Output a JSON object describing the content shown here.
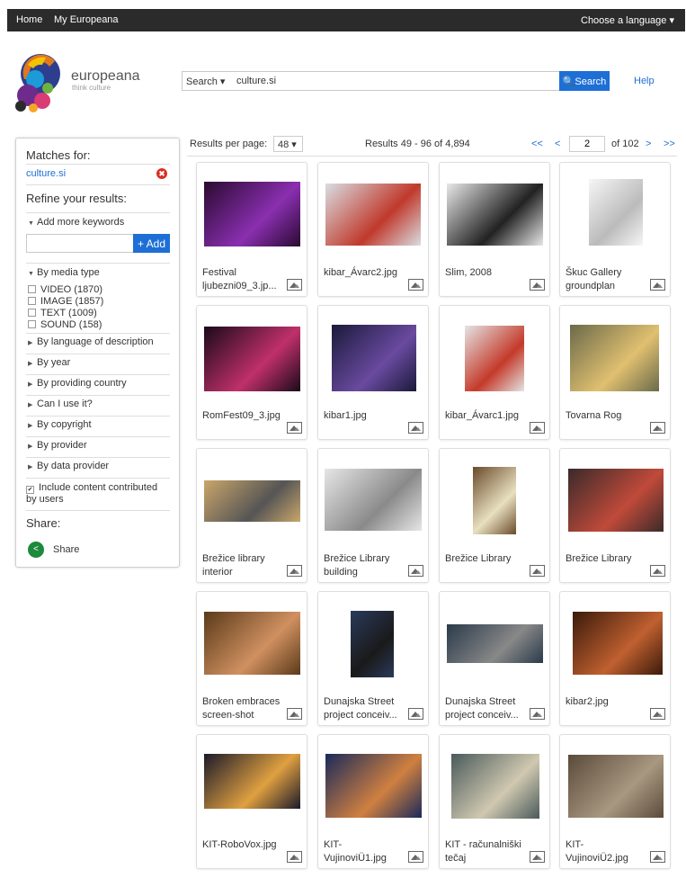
{
  "topbar": {
    "home": "Home",
    "my": "My Europeana",
    "lang": "Choose a language ▾"
  },
  "brand": {
    "name": "europeana",
    "tagline": "think culture"
  },
  "search": {
    "scope": "Search ▾",
    "query": "culture.si",
    "button": "🔍Search",
    "help": "Help"
  },
  "sidebar": {
    "matches_heading": "Matches for:",
    "query": "culture.si",
    "remove_icon": "✖",
    "refine_heading": "Refine your results:",
    "add_keywords": "Add more keywords",
    "add_button": "+ Add",
    "media_type": "By media type",
    "media_types": [
      "VIDEO (1870)",
      "IMAGE (1857)",
      "TEXT (1009)",
      "SOUND (158)"
    ],
    "facets": [
      "By language of description",
      "By year",
      "By providing country",
      "Can I use it?",
      "By copyright",
      "By provider",
      "By data provider"
    ],
    "ugc_label": "Include content contributed by users",
    "share_heading": "Share:",
    "share_label": "Share"
  },
  "results": {
    "rpp_label": "Results per page:",
    "rpp_value": "48 ▾",
    "count": "Results  49 - 96 of 4,894",
    "first": "<<",
    "prev": "<",
    "page": "2",
    "of": "of 102",
    "next": ">",
    "last": ">>"
  },
  "cards": [
    "Festival ljubezni09_3.jp...",
    "kibar_Ávarc2.jpg",
    "Slim, 2008",
    "Škuc Gallery groundplan",
    "RomFest09_3.jpg",
    "kibar1.jpg",
    "kibar_Ávarc1.jpg",
    "Tovarna Rog",
    "Brežice library interior",
    "Brežice Library building",
    "Brežice Library",
    "Brežice Library",
    "Broken embraces screen-shot",
    "Dunajska Street project conceiv...",
    "Dunajska Street project conceiv...",
    "kibar2.jpg",
    "KIT-RoboVox.jpg",
    "KIT-VujinoviÜ1.jpg",
    "KIT - računalniški tečaj",
    "KIT-VujinoviÜ2.jpg"
  ],
  "colors": {
    "accent": "#1d6fd6",
    "topbar": "#2b2b2b",
    "remove": "#d93025",
    "share": "#1c8a3a"
  }
}
